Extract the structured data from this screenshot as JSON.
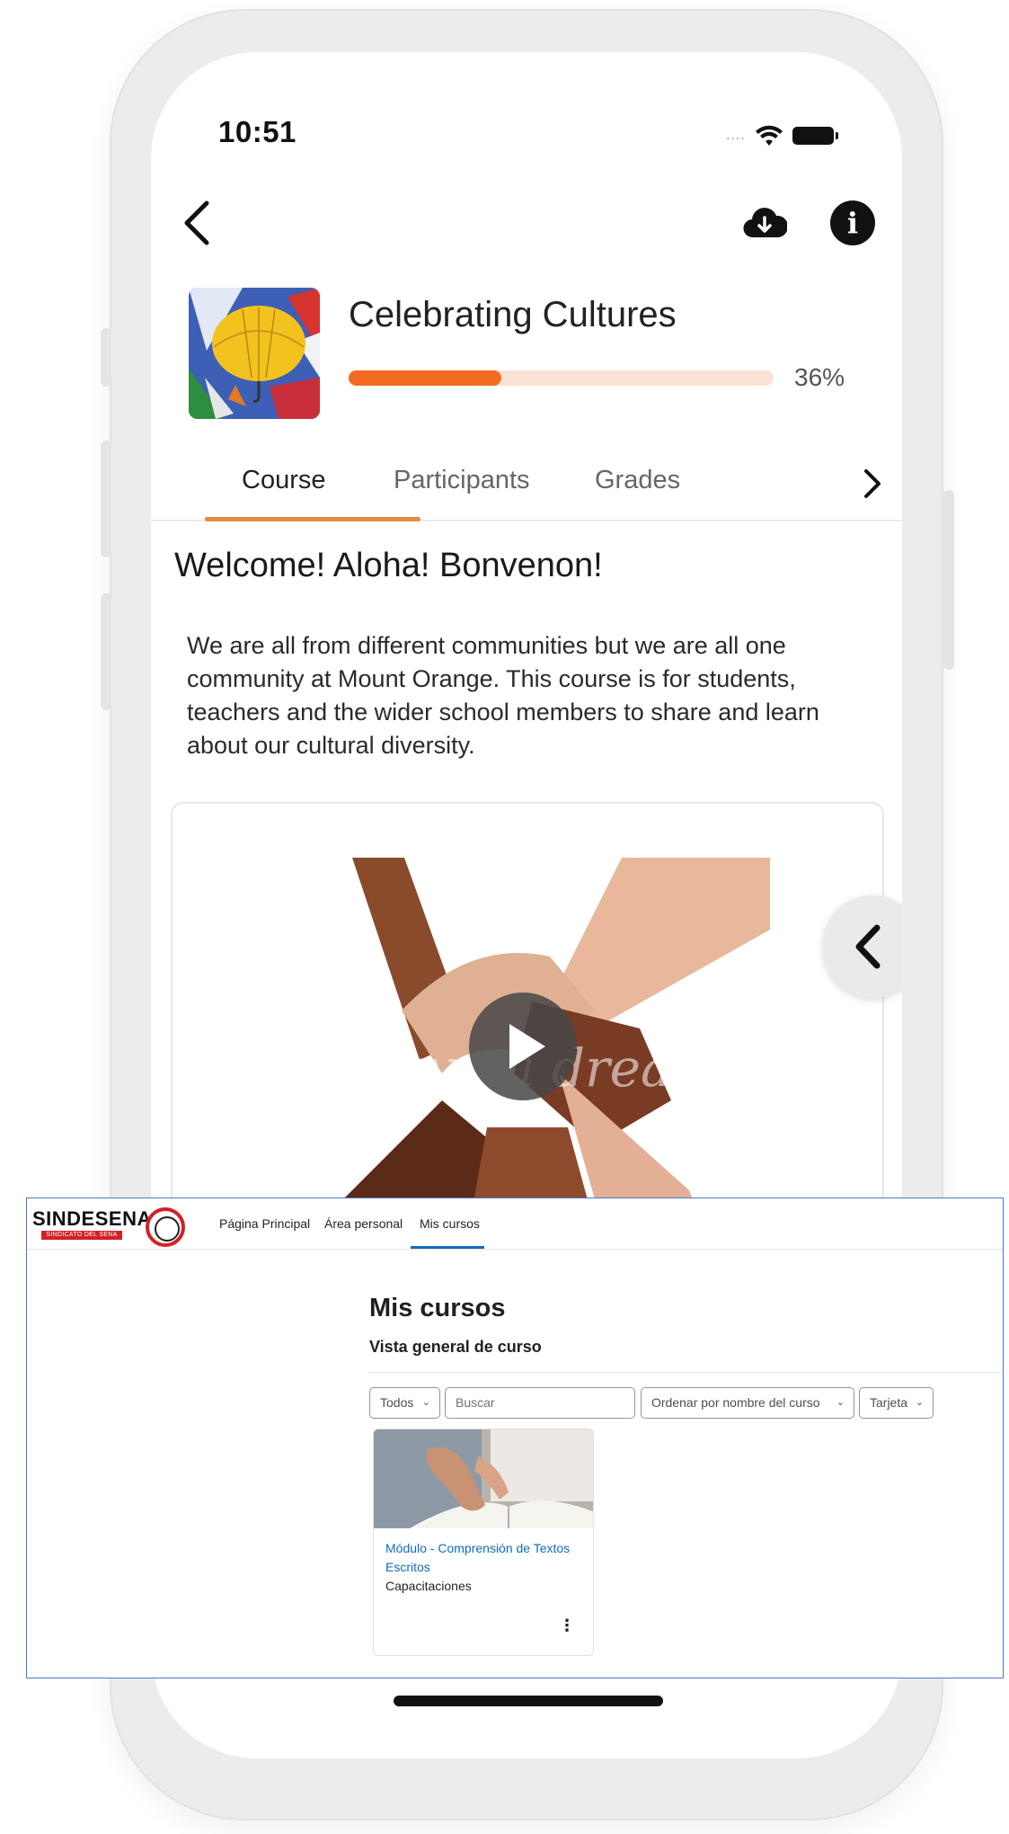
{
  "phone": {
    "status_time": "10:51",
    "signal_dots": "....",
    "course": {
      "title": "Celebrating Cultures",
      "progress_percent": 36,
      "progress_label": "36%"
    },
    "tabs": [
      {
        "label": "Course",
        "active": true
      },
      {
        "label": "Participants",
        "active": false
      },
      {
        "label": "Grades",
        "active": false
      }
    ],
    "welcome_heading": "Welcome! Aloha! Bonvenon!",
    "summary": "We are all from different communities but we are all one community at Mount Orange. This course is for students, teachers and the wider school members to share and learn about our cultural diversity.",
    "video_caption": "I have a dream...",
    "icons": [
      "back-arrow-icon",
      "cloud-download-icon",
      "info-icon",
      "chevron-right-icon",
      "play-icon",
      "chevron-left-icon",
      "wifi-icon",
      "battery-icon"
    ]
  },
  "moodle": {
    "logo": {
      "name": "SINDESENA",
      "subtitle": "SINDICATO DEL SENA"
    },
    "nav": [
      {
        "label": "Página Principal",
        "active": false
      },
      {
        "label": "Área personal",
        "active": false
      },
      {
        "label": "Mis cursos",
        "active": true
      }
    ],
    "page_title": "Mis cursos",
    "section_title": "Vista general de curso",
    "filters": {
      "grouping": "Todos",
      "search_placeholder": "Buscar",
      "sort": "Ordenar por nombre del curso",
      "view": "Tarjeta"
    },
    "courses": [
      {
        "name": "Módulo - Comprensión de Textos Escritos",
        "category": "Capacitaciones"
      }
    ],
    "accent_color": "#0f6cbf"
  }
}
